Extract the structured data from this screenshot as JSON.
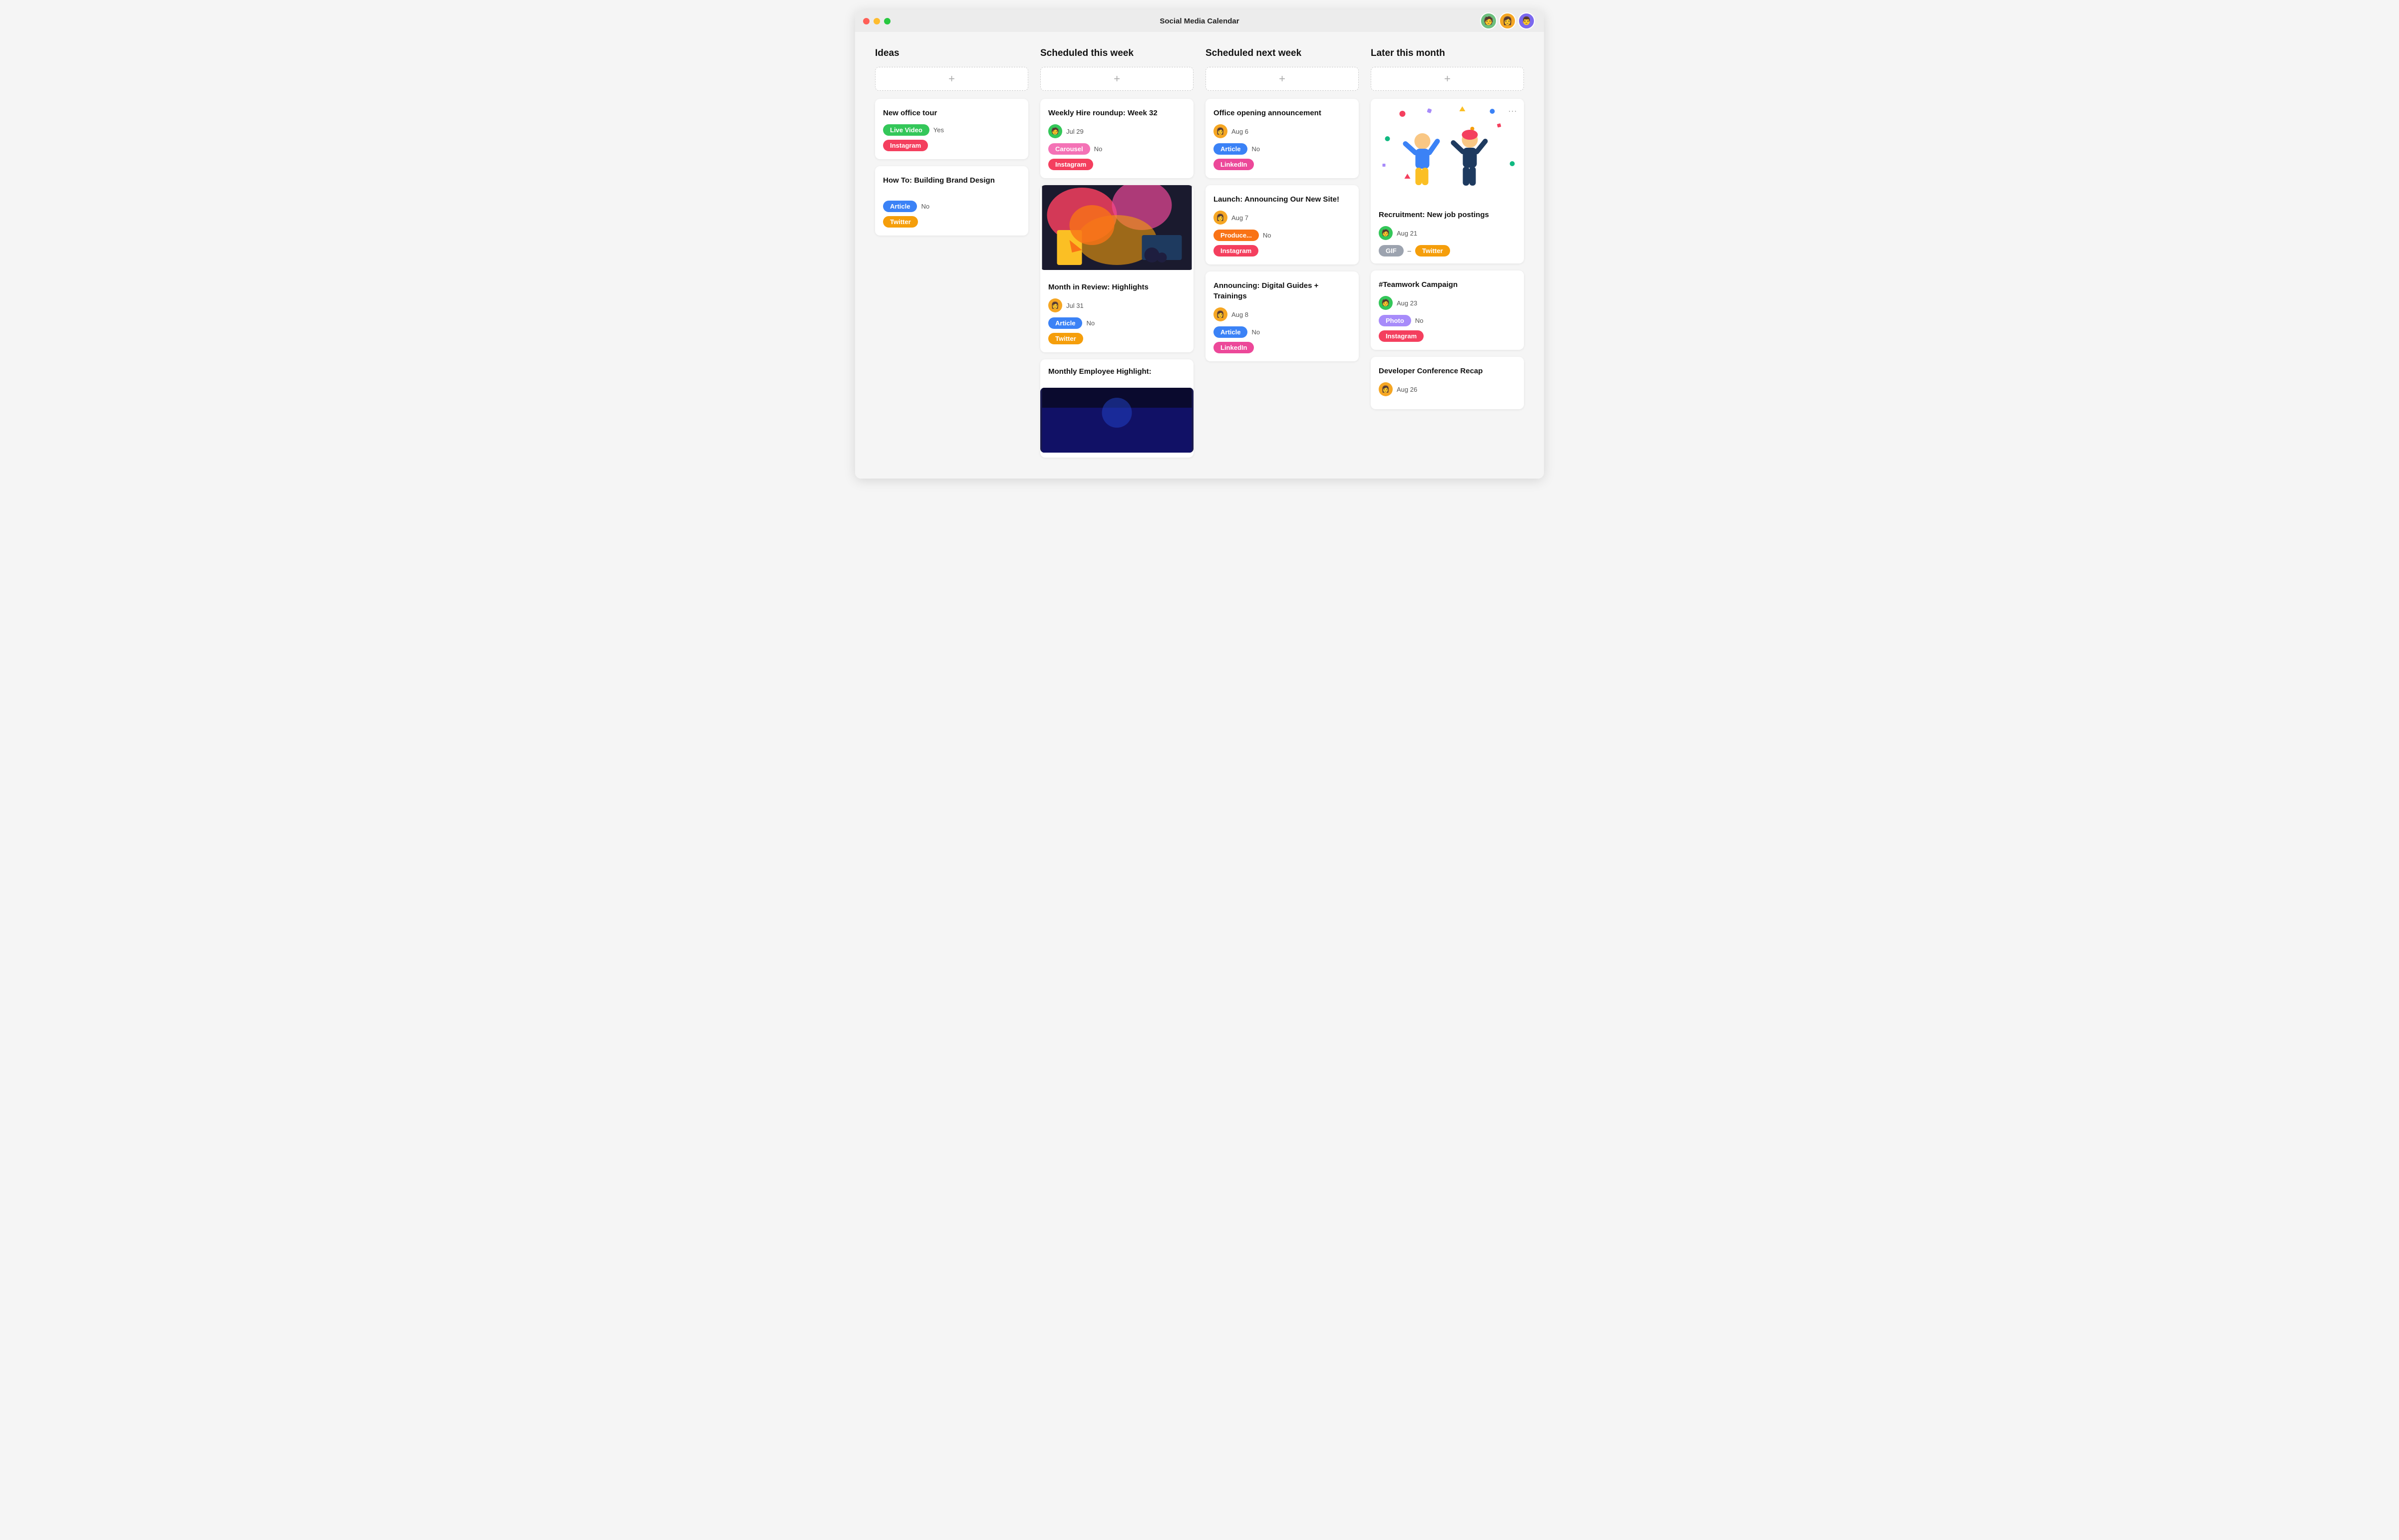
{
  "app": {
    "title": "Social Media Calendar"
  },
  "avatars": [
    {
      "id": "av1",
      "emoji": "🧑",
      "color": "#6dbf7e"
    },
    {
      "id": "av2",
      "emoji": "👩",
      "color": "#f5a623"
    },
    {
      "id": "av3",
      "emoji": "👨",
      "color": "#7b68ee"
    }
  ],
  "columns": [
    {
      "id": "ideas",
      "header": "Ideas",
      "add_label": "+",
      "cards": [
        {
          "id": "c1",
          "title": "New office tour",
          "type_label": "Live Video",
          "type_color": "tag-green",
          "featured": "Yes",
          "tags": [
            "Instagram"
          ],
          "tag_colors": [
            "tag-instagram"
          ]
        },
        {
          "id": "c2",
          "title": "How To: Building Brand Design",
          "type_label": "Article",
          "type_color": "tag-blue",
          "featured": "No",
          "tags": [
            "Twitter"
          ],
          "tag_colors": [
            "tag-twitter"
          ]
        }
      ]
    },
    {
      "id": "scheduled-this-week",
      "header": "Scheduled this week",
      "add_label": "+",
      "cards": [
        {
          "id": "c3",
          "title": "Weekly Hire roundup: Week 32",
          "avatar_color": "#34c759",
          "avatar_emoji": "🧑",
          "date": "Jul 29",
          "type_label": "Carousel",
          "type_color": "tag-carousel",
          "featured": "No",
          "tags": [
            "Instagram"
          ],
          "tag_colors": [
            "tag-instagram"
          ],
          "has_image": false
        },
        {
          "id": "c4",
          "title": "Month in Review: Highlights",
          "avatar_color": "#f5a623",
          "avatar_emoji": "👩",
          "date": "Jul 31",
          "type_label": "Article",
          "type_color": "tag-article",
          "featured": "No",
          "tags": [
            "Twitter"
          ],
          "tag_colors": [
            "tag-twitter"
          ],
          "has_image": true
        },
        {
          "id": "c5",
          "title": "Monthly Employee Highlight:",
          "has_image": true
        }
      ]
    },
    {
      "id": "scheduled-next-week",
      "header": "Scheduled next week",
      "add_label": "+",
      "cards": [
        {
          "id": "c6",
          "title": "Office opening announcement",
          "avatar_color": "#f5a623",
          "avatar_emoji": "👩",
          "date": "Aug 6",
          "type_label": "Article",
          "type_color": "tag-article",
          "featured": "No",
          "tags": [
            "LinkedIn"
          ],
          "tag_colors": [
            "tag-linkedin"
          ]
        },
        {
          "id": "c7",
          "title": "Launch: Announcing Our New Site!",
          "avatar_color": "#f5a623",
          "avatar_emoji": "👩",
          "date": "Aug 7",
          "type_label": "Produce...",
          "type_color": "tag-produce",
          "featured": "No",
          "tags": [
            "Instagram"
          ],
          "tag_colors": [
            "tag-instagram"
          ]
        },
        {
          "id": "c8",
          "title": "Announcing: Digital Guides + Trainings",
          "avatar_color": "#f5a623",
          "avatar_emoji": "👩",
          "date": "Aug 8",
          "type_label": "Article",
          "type_color": "tag-article",
          "featured": "No",
          "tags": [
            "LinkedIn"
          ],
          "tag_colors": [
            "tag-linkedin"
          ]
        }
      ]
    },
    {
      "id": "later-this-month",
      "header": "Later this month",
      "add_label": "+",
      "cards": [
        {
          "id": "c9",
          "title": "Recruitment: New job postings",
          "avatar_color": "#34c759",
          "avatar_emoji": "🧑",
          "date": "Aug 21",
          "type_label": "GIF",
          "type_color": "tag-gif",
          "tags": [
            "Twitter"
          ],
          "tag_colors": [
            "tag-twitter"
          ],
          "has_illustration": true
        },
        {
          "id": "c10",
          "title": "#Teamwork Campaign",
          "avatar_color": "#34c759",
          "avatar_emoji": "🧑",
          "date": "Aug 23",
          "type_label": "Photo",
          "type_color": "tag-photo",
          "featured": "No",
          "tags": [
            "Instagram"
          ],
          "tag_colors": [
            "tag-instagram"
          ]
        },
        {
          "id": "c11",
          "title": "Developer Conference Recap",
          "avatar_color": "#f5a623",
          "avatar_emoji": "👩",
          "date": "Aug 26"
        }
      ]
    }
  ]
}
